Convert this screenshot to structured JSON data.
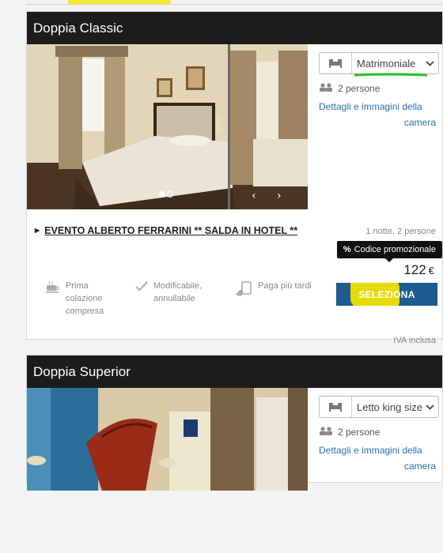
{
  "rooms": [
    {
      "title": "Doppia Classic",
      "bed_type": "Matrimoniale",
      "persons": "2 persone",
      "details_link": [
        "Dettagli e immagini della",
        "camera"
      ],
      "offer": {
        "title": "EVENTO ALBERTO FERRARINI ** SALDA IN HOTEL **",
        "nights": "1 notte, 2 persone",
        "promo_label": "Codice promozionale",
        "price": "122",
        "currency": "€",
        "select_label": "SELEZIONA",
        "tax_note": "IVA inclusa",
        "features": [
          {
            "icon": "coffee-cup-icon",
            "lines": [
              "Prima",
              "colazione",
              "compresa"
            ]
          },
          {
            "icon": "checkmark-icon",
            "lines": [
              "Modificabile,",
              "annullabile"
            ]
          },
          {
            "icon": "hand-card-icon",
            "lines": [
              "Paga più tardi"
            ]
          }
        ]
      }
    },
    {
      "title": "Doppia Superior",
      "bed_type": "Letto king size",
      "persons": "2 persone",
      "details_link": [
        "Dettagli e immagini della",
        "camera"
      ]
    }
  ],
  "colors": {
    "header": "#1c1c1c",
    "button": "#1e5b8e",
    "link": "#2a73a8",
    "highlight_yellow": "#f0e400",
    "highlight_green": "#1fc51f"
  }
}
